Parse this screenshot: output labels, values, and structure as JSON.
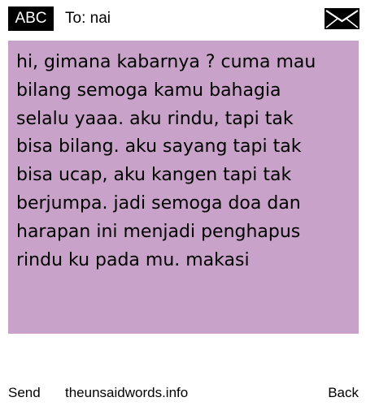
{
  "header": {
    "input_mode": "ABC",
    "recipient": "To: nai",
    "envelope_icon": "envelope-icon"
  },
  "message": {
    "text": "hi, gimana kabarnya ? cuma mau\nbilang semoga kamu bahagia\nselalu yaaa. aku rindu, tapi tak\nbisa bilang. aku sayang tapi tak\nbisa ucap, aku kangen tapi tak\nberjumpa. jadi semoga doa dan\nharapan ini menjadi penghapus\nrindu ku pada mu. makasi",
    "background": "#c8a2c8"
  },
  "footer": {
    "send_label": "Send",
    "site_label": "theunsaidwords.info",
    "back_label": "Back"
  }
}
